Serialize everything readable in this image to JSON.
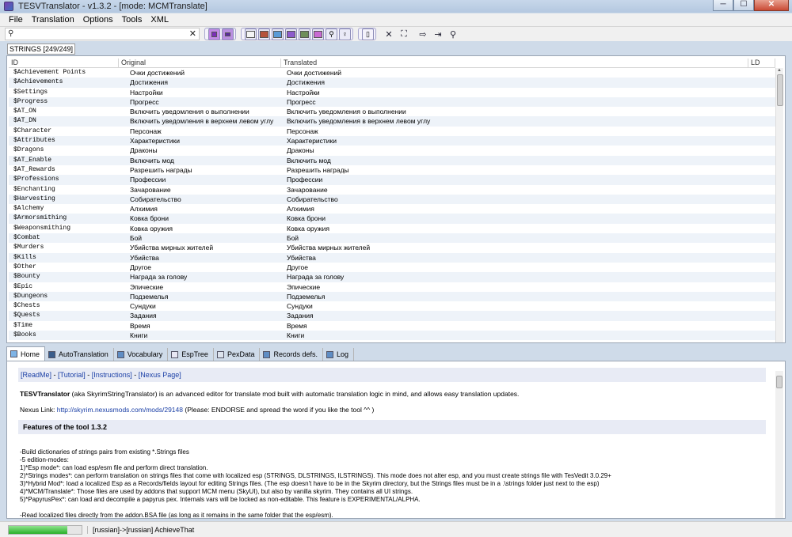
{
  "window": {
    "title": "TESVTranslator - v1.3.2 - [mode: MCMTranslate]",
    "minimize": "─",
    "maximize": "☐",
    "close": "✕"
  },
  "menu": [
    "File",
    "Translation",
    "Options",
    "Tools",
    "XML"
  ],
  "search": {
    "value": "",
    "placeholder": ""
  },
  "strings_tab": "STRINGS [249/249]",
  "grid": {
    "columns": [
      "ID",
      "Original",
      "Translated",
      "LD"
    ],
    "rows": [
      [
        "$Achievement Points",
        "Очки достижений",
        "Очки достижений"
      ],
      [
        "$Achievements",
        "Достижения",
        "Достижения"
      ],
      [
        "$Settings",
        "Настройки",
        "Настройки"
      ],
      [
        "$Progress",
        "Прогресс",
        "Прогресс"
      ],
      [
        "$AT_ON",
        "Включить уведомления о выполнении",
        "Включить уведомления о выполнении"
      ],
      [
        "$AT_DN",
        "Включить уведомления в верхнем левом углу",
        "Включить уведомления в верхнем левом углу"
      ],
      [
        "$Character",
        "Персонаж",
        "Персонаж"
      ],
      [
        "$Attributes",
        "Характеристики",
        "Характеристики"
      ],
      [
        "$Dragons",
        "Драконы",
        "Драконы"
      ],
      [
        "$AT_Enable",
        "Включить мод",
        "Включить мод"
      ],
      [
        "$AT_Rewards",
        "Разрешить награды",
        "Разрешить награды"
      ],
      [
        "$Professions",
        "Профессии",
        "Профессии"
      ],
      [
        "$Enchanting",
        "Зачарование",
        "Зачарование"
      ],
      [
        "$Harvesting",
        "Собирательство",
        "Собирательство"
      ],
      [
        "$Alchemy",
        "Алхимия",
        "Алхимия"
      ],
      [
        "$Armorsmithing",
        "Ковка брони",
        "Ковка брони"
      ],
      [
        "$Weaponsmithing",
        "Ковка оружия",
        "Ковка оружия"
      ],
      [
        "$Combat",
        "Бой",
        "Бой"
      ],
      [
        "$Murders",
        "Убийства мирных жителей",
        "Убийства мирных жителей"
      ],
      [
        "$Kills",
        "Убийства",
        "Убийства"
      ],
      [
        "$Other",
        "Другое",
        "Другое"
      ],
      [
        "$Bounty",
        "Награда за голову",
        "Награда за голову"
      ],
      [
        "$Epic",
        "Эпические",
        "Эпические"
      ],
      [
        "$Dungeons",
        "Подземелья",
        "Подземелья"
      ],
      [
        "$Chests",
        "Сундуки",
        "Сундуки"
      ],
      [
        "$Quests",
        "Задания",
        "Задания"
      ],
      [
        "$Time",
        "Время",
        "Время"
      ],
      [
        "$Books",
        "Книги",
        "Книги"
      ]
    ]
  },
  "bottom_tabs": [
    "Home",
    "AutoTranslation",
    "Vocabulary",
    "EspTree",
    "PexData",
    "Records defs.",
    "Log"
  ],
  "home": {
    "links": [
      "[ReadMe]",
      "[Tutorial]",
      "[Instructions]",
      "[Nexus Page]"
    ],
    "link_sep": " - ",
    "intro_bold": "TESVTranslator",
    "intro_rest": " (aka SkyrimStringTranslator) is an advanced editor for translate mod built with automatic translation logic in mind, and allows easy translation updates.",
    "nexus_label": "Nexus Link: ",
    "nexus_url": "http://skyrim.nexusmods.com/mods/29148",
    "nexus_note": " (Please: ENDORSE and spread the word if you like the tool ^^ )",
    "features_title": "Features of the tool 1.3.2",
    "features": [
      "-Build dictionaries of strings pairs from existing *.Strings files",
      "-5 edition-modes:",
      "1)*Esp mode*: can load esp/esm file and perform direct translation.",
      "2)*Strings modes*: can perform translation on strings files that come with localized esp (STRINGS, DLSTRINGS, ILSTRINGS). This mode does not alter esp, and you must create strings file with TesVedit 3.0.29+",
      "3)*Hybrid Mod*: load a localized Esp as a Records/fields layout for editing Strings files. (The esp doesn't have to be in the Skyrim directory, but the Strings files must be in a .\\strings folder just next to the esp)",
      "4)*MCM/Translate*: Those files are used by addons that support MCM menu (SkyUI), but also by vanilla skyrim. They contains all UI strings.",
      "5)*PapyrusPex*: can load and decompile a papyrus pex. Internals vars will be locked as non-editable. This feature is EXPERIMENTAL/ALPHA.",
      "",
      "-Read localized files directly from the addon.BSA file (as long as it remains in the same folder that the esp/esm)."
    ]
  },
  "status": {
    "progress": 0.8,
    "text": "[russian]->[russian] AchieveThat"
  }
}
